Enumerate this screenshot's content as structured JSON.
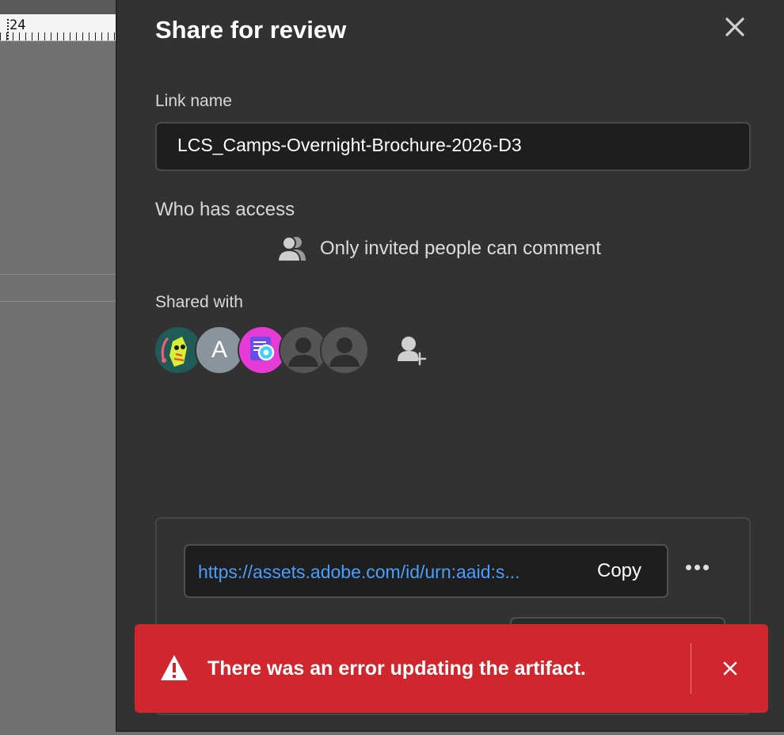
{
  "background": {
    "ruler_number": "24"
  },
  "dialog": {
    "title": "Share for review",
    "link_name_label": "Link name",
    "link_name_value": "LCS_Camps-Overnight-Brochure-2026-D3",
    "access_label": "Who has access",
    "access_value": "Only invited people can comment",
    "shared_with_label": "Shared with",
    "avatars": [
      {
        "type": "image",
        "icon": "avatar-illustration-icon"
      },
      {
        "type": "letter",
        "letter": "A"
      },
      {
        "type": "image",
        "icon": "avatar-app-icon"
      },
      {
        "type": "placeholder",
        "icon": "person-icon"
      },
      {
        "type": "placeholder",
        "icon": "person-icon"
      }
    ],
    "share_url": "https://assets.adobe.com/id/urn:aaid:s...",
    "copy_label": "Copy"
  },
  "toast": {
    "message": "There was an error updating the artifact.",
    "color": "#d0262d"
  },
  "colors": {
    "dialog_bg": "#323232",
    "link": "#4a9eff"
  }
}
